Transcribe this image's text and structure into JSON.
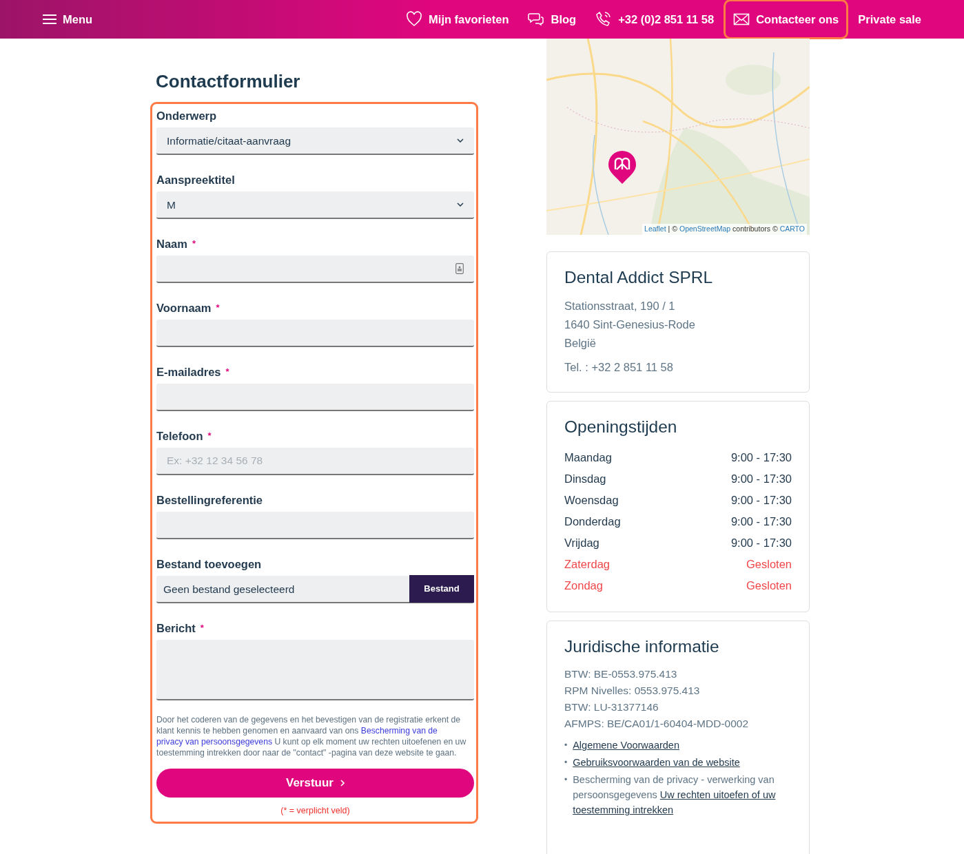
{
  "navbar": {
    "menu_label": "Menu",
    "items": [
      {
        "kind": "heart",
        "label": "Mijn favorieten",
        "selected": false
      },
      {
        "kind": "chat",
        "label": "Blog",
        "selected": false
      },
      {
        "kind": "phone",
        "label": "+32 (0)2 851 11 58",
        "selected": false
      },
      {
        "kind": "mail",
        "label": "Contacteer ons",
        "selected": true
      },
      {
        "kind": "plain",
        "label": "Private sale",
        "selected": false
      }
    ]
  },
  "form": {
    "title": "Contactformulier",
    "fields": [
      {
        "kind": "select",
        "label": "Onderwerp",
        "value": "Informatie/citaat-aanvraag"
      },
      {
        "kind": "select",
        "label": "Aanspreektitel",
        "value": "M"
      },
      {
        "kind": "autofill",
        "label": "Naam",
        "mark": "*"
      },
      {
        "kind": "text",
        "label": "Voornaam",
        "mark": "*"
      },
      {
        "kind": "text",
        "label": "E-mailadres",
        "mark": "*"
      },
      {
        "kind": "text",
        "label": "Telefoon",
        "mark": "*",
        "placeholder": "Ex: +32 12 34 56 78"
      },
      {
        "kind": "text",
        "label": "Bestellingreferentie"
      },
      {
        "kind": "file",
        "label": "Bestand toevoegen",
        "value": "Geen bestand geselecteerd",
        "button": "Bestand"
      },
      {
        "kind": "textarea",
        "label": "Bericht",
        "mark": "*"
      }
    ],
    "consent": {
      "before": "Door het coderen van de gegevens en het bevestigen van de registratie erkent de klant kennis te hebben genomen en aanvaard van ons ",
      "link": [
        "Bescherming van de",
        "privacy van persoonsgegevens"
      ],
      "after": " U kunt op elk moment uw rechten uitoefenen en uw toestemming intrekken door naar de \"contact\" -pagina van deze website te gaan."
    },
    "submit": "Verstuur",
    "required_note": "(* = verplicht veld)"
  },
  "map": {
    "kind": "picture",
    "attribution": [
      {
        "text": "Leaflet",
        "link": true
      },
      {
        "text": "| ©",
        "link": false
      },
      {
        "text": "OpenStreetMap",
        "link": true
      },
      {
        "text": "contributors ©",
        "link": false
      },
      {
        "text": "CARTO",
        "link": true
      }
    ]
  },
  "company": {
    "name": "Dental Addict SPRL",
    "address": [
      "Stationsstraat, 190 / 1",
      "1640 Sint-Genesius-Rode",
      "België"
    ],
    "phone": "Tel. : +32 2 851 11 58"
  },
  "hours": {
    "title": "Openingstijden",
    "rows": [
      {
        "day": "Maandag",
        "time": "9:00 - 17:30",
        "closed": false
      },
      {
        "day": "Dinsdag",
        "time": "9:00 - 17:30",
        "closed": false
      },
      {
        "day": "Woensdag",
        "time": "9:00 - 17:30",
        "closed": false
      },
      {
        "day": "Donderdag",
        "time": "9:00 - 17:30",
        "closed": false
      },
      {
        "day": "Vrijdag",
        "time": "9:00 - 17:30",
        "closed": false
      },
      {
        "day": "Zaterdag",
        "time": "Gesloten",
        "closed": true
      },
      {
        "day": "Zondag",
        "time": "Gesloten",
        "closed": true
      }
    ]
  },
  "legal": {
    "title": "Juridische informatie",
    "lines": [
      "BTW: BE-0553.975.413",
      "RPM Nivelles: 0553.975.413",
      "BTW: LU-31377146",
      "AFMPS: BE/CA01/1-60404-MDD-0002"
    ],
    "links": [
      {
        "bullet": "•",
        "link": [
          "Algemene Voorwaarden"
        ]
      },
      {
        "bullet": "•",
        "link": [
          "Gebruiksvoorwaarden van de website"
        ]
      },
      {
        "bullet": "•",
        "text": "Bescherming van de privacy - verwerking van persoonsgegevens",
        "link": [
          "Uw rechten uitoefen of uw",
          "toestemming intrekken"
        ]
      }
    ]
  }
}
